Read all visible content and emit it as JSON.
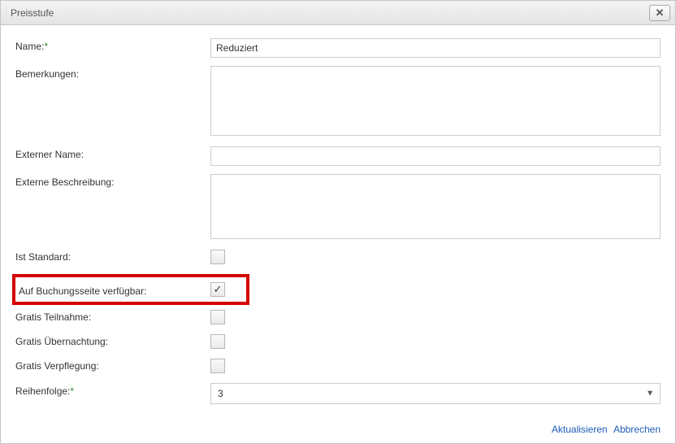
{
  "dialog": {
    "title": "Preisstufe"
  },
  "labels": {
    "name": "Name:",
    "remarks": "Bemerkungen:",
    "external_name": "Externer Name:",
    "external_desc": "Externe Beschreibung:",
    "is_standard": "Ist Standard:",
    "booking_available": "Auf Buchungsseite verfügbar:",
    "free_participation": "Gratis Teilnahme:",
    "free_accommodation": "Gratis Übernachtung:",
    "free_catering": "Gratis Verpflegung:",
    "order": "Reihenfolge:",
    "required_mark": "*"
  },
  "values": {
    "name": "Reduziert",
    "remarks": "",
    "external_name": "",
    "external_desc": "",
    "is_standard": false,
    "booking_available": true,
    "free_participation": false,
    "free_accommodation": false,
    "free_catering": false,
    "order": "3"
  },
  "checks": {
    "checked": "✓",
    "unchecked": ""
  },
  "footer": {
    "update": "Aktualisieren",
    "cancel": "Abbrechen"
  }
}
